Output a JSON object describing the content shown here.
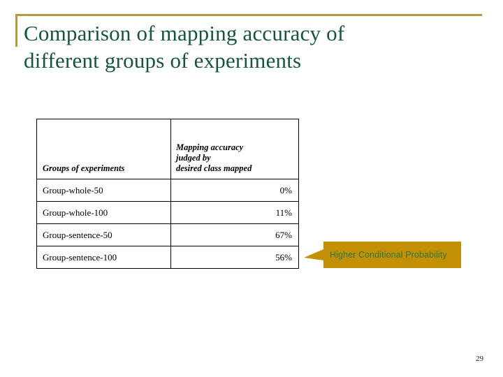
{
  "slide": {
    "title_line_1": "Comparison of mapping accuracy of",
    "title_line_2": "different groups of experiments",
    "page_number": "29",
    "title_color": "#14563a",
    "rule_color": "#b39a3b"
  },
  "table": {
    "headers": {
      "col_1": "Groups of experiments",
      "col_2_line_1": "Mapping accuracy",
      "col_2_line_2": "judged by",
      "col_2_line_3": "desired class mapped"
    },
    "rows": [
      {
        "group": "Group-whole-50",
        "accuracy": "0%"
      },
      {
        "group": "Group-whole-100",
        "accuracy": "11%"
      },
      {
        "group": "Group-sentence-50",
        "accuracy": "67%"
      },
      {
        "group": "Group-sentence-100",
        "accuracy": "56%"
      }
    ]
  },
  "callout": {
    "label": "Higher Conditional Probability",
    "fill_color": "#c28f05",
    "text_color": "#2c7a3f"
  }
}
